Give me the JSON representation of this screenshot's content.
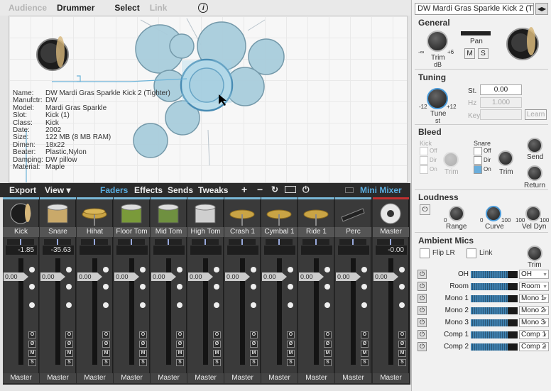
{
  "tabs": {
    "audience": "Audience",
    "drummer": "Drummer",
    "select": "Select",
    "link": "Link",
    "info": "i"
  },
  "meta": [
    {
      "k": "Name:",
      "v": "DW Mardi Gras Sparkle Kick 2 (Tighter)"
    },
    {
      "k": "Manufctr:",
      "v": "DW"
    },
    {
      "k": "Model:",
      "v": "Mardi Gras Sparkle"
    },
    {
      "k": "Slot:",
      "v": "Kick (1)"
    },
    {
      "k": "Class:",
      "v": "Kick"
    },
    {
      "k": "Date:",
      "v": "2002"
    },
    {
      "k": "Size:",
      "v": "122 MB (8 MB RAM)"
    },
    {
      "k": "Dimen:",
      "v": "18x22"
    },
    {
      "k": "Beater:",
      "v": "Plastic,Nylon"
    },
    {
      "k": "Damping:",
      "v": "DW pillow"
    },
    {
      "k": "Material:",
      "v": "Maple"
    }
  ],
  "mixbar": {
    "export": "Export",
    "view": "View ▾",
    "faders": "Faders",
    "effects": "Effects",
    "sends": "Sends",
    "tweaks": "Tweaks",
    "plus": "+",
    "minus": "−",
    "mini_mixer": "Mini Mixer",
    "accent": "#5aaee0"
  },
  "channels": [
    {
      "name": "Kick",
      "vol": "-1.85",
      "fader": "0.00",
      "out": "Master",
      "icon": "kick-drum-icon"
    },
    {
      "name": "Snare",
      "vol": "-35.63",
      "fader": "0.00",
      "out": "Master",
      "icon": "snare-drum-icon"
    },
    {
      "name": "Hihat",
      "vol": "",
      "fader": "0.00",
      "out": "Master",
      "icon": "hihat-icon"
    },
    {
      "name": "Floor Tom",
      "vol": "",
      "fader": "0.00",
      "out": "Master",
      "icon": "floor-tom-icon"
    },
    {
      "name": "Mid Tom",
      "vol": "",
      "fader": "0.00",
      "out": "Master",
      "icon": "mid-tom-icon"
    },
    {
      "name": "High Tom",
      "vol": "",
      "fader": "0.00",
      "out": "Master",
      "icon": "high-tom-icon"
    },
    {
      "name": "Crash 1",
      "vol": "",
      "fader": "0.00",
      "out": "Master",
      "icon": "crash-cymbal-icon"
    },
    {
      "name": "Cymbal 1",
      "vol": "",
      "fader": "0.00",
      "out": "Master",
      "icon": "cymbal-icon"
    },
    {
      "name": "Ride 1",
      "vol": "",
      "fader": "0.00",
      "out": "Master",
      "icon": "ride-cymbal-icon"
    },
    {
      "name": "Perc",
      "vol": "",
      "fader": "0.00",
      "out": "Master",
      "icon": "percussion-icon"
    }
  ],
  "master": {
    "name": "Master",
    "vol": "-0.00",
    "fader": "0.00",
    "out": "Master",
    "icon": "speaker-icon"
  },
  "strip_buttons": [
    "O",
    "Ø",
    "M",
    "S"
  ],
  "panel": {
    "instrument": "DW Mardi Gras Sparkle Kick 2 (Tighter)",
    "general": "General",
    "pan": "Pan",
    "trim": "Trim",
    "db": "dB",
    "minus_inf": "-∞",
    "plus6": "+6",
    "m": "M",
    "s": "S",
    "tuning": "Tuning",
    "tune": "Tune",
    "st": "st",
    "st_label": "St.",
    "st_value": "0.00",
    "hz_label": "Hz",
    "hz_value": "1.000",
    "key_label": "Key",
    "learn": "Learn",
    "minus12": "-12",
    "plus12": "+12",
    "bleed": "Bleed",
    "kick": "Kick",
    "snare": "Snare",
    "off": "Off",
    "dir": "Dir",
    "on": "On",
    "send": "Send",
    "return": "Return",
    "loudness": "Loudness",
    "range": "Range",
    "curve": "Curve",
    "vel_dyn": "Vel Dyn",
    "zero": "0",
    "hundred": "100",
    "ambient": "Ambient Mics",
    "flip_lr": "Flip LR",
    "link": "Link",
    "mics": [
      {
        "name": "OH",
        "out": "OH"
      },
      {
        "name": "Room",
        "out": "Room"
      },
      {
        "name": "Mono 1",
        "out": "Mono 1"
      },
      {
        "name": "Mono 2",
        "out": "Mono 2"
      },
      {
        "name": "Mono 3",
        "out": "Mono 3"
      },
      {
        "name": "Comp 1",
        "out": "Comp 1"
      },
      {
        "name": "Comp 2",
        "out": "Comp 2"
      }
    ]
  }
}
